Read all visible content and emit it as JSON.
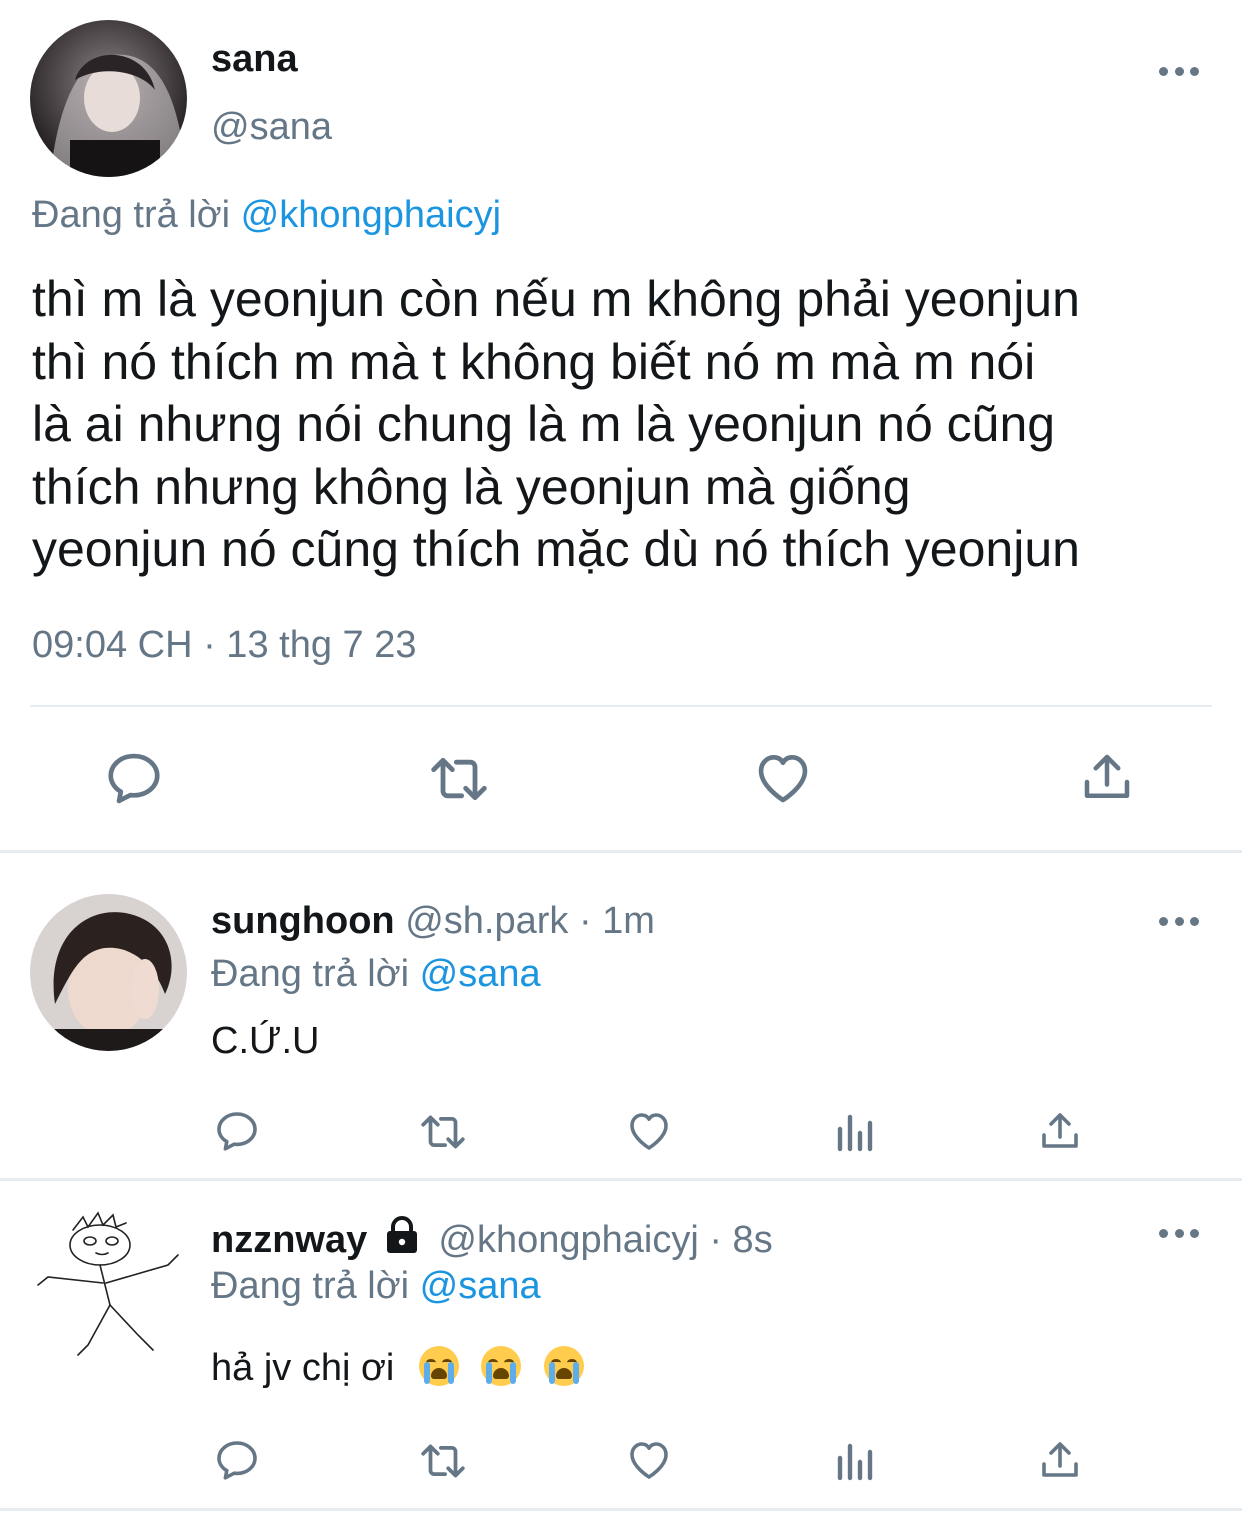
{
  "main_tweet": {
    "display_name": "sana",
    "handle": "@sana",
    "replying_prefix": "Đang trả lời",
    "replying_to": "@khongphaicyj",
    "text_lines": [
      "thì m là yeonjun còn nếu m không phải yeonjun",
      "thì nó thích m mà t không biết nó m mà m nói",
      "là ai nhưng nói chung là m là yeonjun nó cũng",
      "thích nhưng không là yeonjun mà giống",
      "yeonjun nó cũng thích mặc dù nó thích yeonjun"
    ],
    "timestamp": "09:04 CH · 13 thg 7 23",
    "actions": [
      "reply-icon",
      "retweet-icon",
      "like-icon",
      "share-icon"
    ]
  },
  "replies": [
    {
      "display_name": "sunghoon",
      "handle": "@sh.park",
      "time": "· 1m",
      "replying_prefix": "Đang trả lời",
      "replying_to": "@sana",
      "text": "C.Ứ.U",
      "actions": [
        "reply-icon",
        "retweet-icon",
        "like-icon",
        "analytics-icon",
        "share-icon"
      ]
    },
    {
      "display_name": "nzznway",
      "protected": true,
      "handle": "@khongphaicyj",
      "time": "· 8s",
      "replying_prefix": "Đang trả lời",
      "replying_to": "@sana",
      "text": "hả jv chị ơi",
      "emoji": [
        "loudly-crying-face-emoji",
        "loudly-crying-face-emoji",
        "loudly-crying-face-emoji"
      ],
      "actions": [
        "reply-icon",
        "retweet-icon",
        "like-icon",
        "analytics-icon",
        "share-icon"
      ]
    }
  ],
  "colors": {
    "link": "#1b95e0",
    "secondary_text": "#657786",
    "primary_text": "#14171a",
    "separator": "#e6ecf0"
  }
}
